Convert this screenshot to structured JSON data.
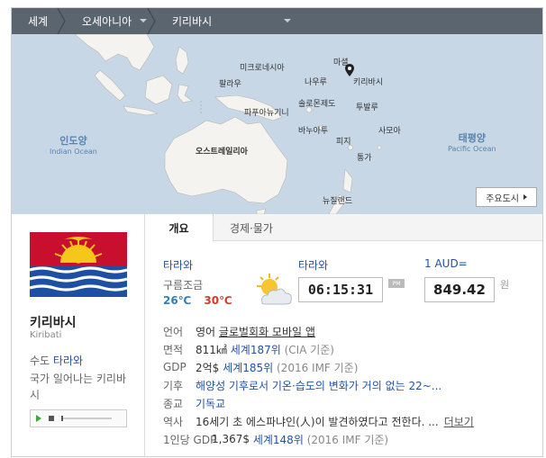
{
  "breadcrumb": [
    "세계",
    "오세아니아",
    "키리바시"
  ],
  "map": {
    "labels": {
      "micronesia": "미크로네시아",
      "palau": "팔라우",
      "papua": "파푸아뉴기니",
      "nauru": "나우루",
      "marshall": "마셜",
      "kiribati": "키리바시",
      "solomon": "솔로몬제도",
      "tuvalu": "투발루",
      "vanuatu": "바누아투",
      "fiji": "피지",
      "samoa": "사모아",
      "tonga": "통가",
      "australia": "오스트레일리아",
      "newzealand": "뉴질랜드"
    },
    "oceans": [
      {
        "ko": "인도양",
        "en": "Indian Ocean"
      },
      {
        "ko": "태평양",
        "en": "Pacific Ocean"
      }
    ],
    "button_label": "주요도시"
  },
  "country": {
    "name_ko": "키리바시",
    "name_en": "Kiribati",
    "capital_label": "수도",
    "capital": "타라와",
    "anthem": "국가 일어나는 키리바시"
  },
  "tabs": [
    "개요",
    "경제·물가"
  ],
  "weather": {
    "city": "타라와",
    "condition": "구름조금",
    "low": "26℃",
    "high": "30℃"
  },
  "clock": {
    "city": "타라와",
    "time": "06:15:31",
    "ampm": "PM"
  },
  "currency": {
    "label": "1 AUD=",
    "value": "849.42",
    "unit": "원"
  },
  "info": {
    "language": {
      "k": "언어",
      "v": "영어",
      "link": "글로벌회화 모바일 앱"
    },
    "area": {
      "k": "면적",
      "v": "811㎢",
      "rank": "세계187위",
      "src": "(CIA 기준)"
    },
    "gdp": {
      "k": "GDP",
      "v": "2억$",
      "rank": "세계185위",
      "src": "(2016 IMF 기준)"
    },
    "climate": {
      "k": "기후",
      "v": "해양성 기후로서 기온·습도의 변화가 거의 없는 22~..."
    },
    "religion": {
      "k": "종교",
      "v": "기독교"
    },
    "history": {
      "k": "역사",
      "v": "16세기 초 에스파냐인(人)이 발견하였다고 전한다. ...",
      "more": "더보기"
    },
    "gdp_per": {
      "k": "1인당 GDP",
      "v": "1,367$",
      "rank": "세계148위",
      "src": "(2016 IMF 기준)"
    }
  }
}
